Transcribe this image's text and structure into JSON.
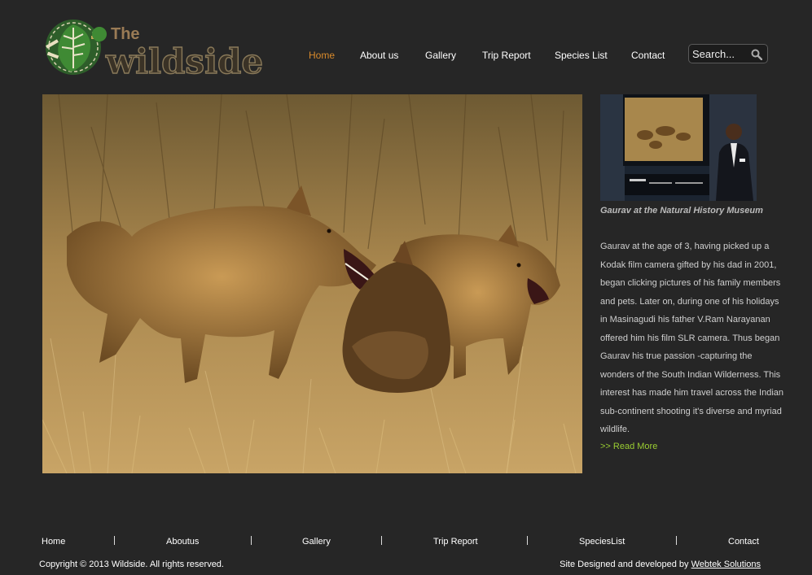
{
  "logo": {
    "small_word": "The",
    "big_word": "wildside"
  },
  "nav": {
    "items": [
      {
        "label": "Home",
        "active": true
      },
      {
        "label": "About us"
      },
      {
        "label": "Gallery"
      },
      {
        "label": "Trip Report"
      },
      {
        "label": "Species List"
      },
      {
        "label": "Contact"
      }
    ],
    "active_color": "#d98a2b"
  },
  "search": {
    "placeholder": "Search..."
  },
  "hero": {
    "subject": "two snarling jackals in dry grassland"
  },
  "sidebar": {
    "caption": "Gaurav at the Natural History Museum",
    "bio": "Gaurav at the age of 3, having picked up a Kodak film camera gifted by his dad in 2001, began clicking pictures of his family members and pets. Later on, during one of his holidays in Masinagudi his father V.Ram Narayanan offered him his film SLR camera. Thus began Gaurav his true passion -capturing the wonders of the South Indian Wilderness. This interest has made him travel across the Indian sub-continent shooting it's diverse and myriad wildlife.",
    "read_more": ">> Read More",
    "read_more_color": "#9acd32"
  },
  "footer": {
    "nav": [
      "Home",
      "Aboutus",
      "Gallery",
      "Trip Report",
      "SpeciesList",
      "Contact"
    ],
    "copyright": "Copyright © 2013 Wildside. All rights reserved.",
    "credit_prefix": "Site Designed and developed by ",
    "credit_link": "Webtek Solutions"
  },
  "colors": {
    "background": "#262626",
    "text": "#ffffff"
  }
}
